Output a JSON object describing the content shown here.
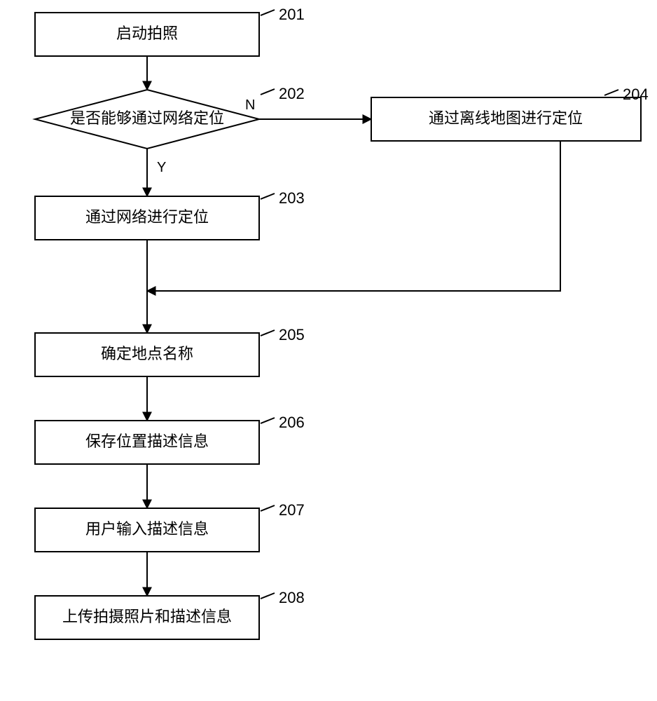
{
  "nodes": {
    "n201": {
      "label": "启动拍照",
      "ref": "201"
    },
    "n202": {
      "label": "是否能够通过网络定位",
      "ref": "202",
      "yes": "Y",
      "no": "N"
    },
    "n203": {
      "label": "通过网络进行定位",
      "ref": "203"
    },
    "n204": {
      "label": "通过离线地图进行定位",
      "ref": "204"
    },
    "n205": {
      "label": "确定地点名称",
      "ref": "205"
    },
    "n206": {
      "label": "保存位置描述信息",
      "ref": "206"
    },
    "n207": {
      "label": "用户输入描述信息",
      "ref": "207"
    },
    "n208": {
      "label": "上传拍摄照片和描述信息",
      "ref": "208"
    }
  },
  "chart_data": {
    "type": "flowchart",
    "nodes": [
      {
        "id": "201",
        "shape": "process",
        "text": "启动拍照"
      },
      {
        "id": "202",
        "shape": "decision",
        "text": "是否能够通过网络定位"
      },
      {
        "id": "203",
        "shape": "process",
        "text": "通过网络进行定位"
      },
      {
        "id": "204",
        "shape": "process",
        "text": "通过离线地图进行定位"
      },
      {
        "id": "205",
        "shape": "process",
        "text": "确定地点名称"
      },
      {
        "id": "206",
        "shape": "process",
        "text": "保存位置描述信息"
      },
      {
        "id": "207",
        "shape": "process",
        "text": "用户输入描述信息"
      },
      {
        "id": "208",
        "shape": "process",
        "text": "上传拍摄照片和描述信息"
      }
    ],
    "edges": [
      {
        "from": "201",
        "to": "202",
        "label": ""
      },
      {
        "from": "202",
        "to": "203",
        "label": "Y"
      },
      {
        "from": "202",
        "to": "204",
        "label": "N"
      },
      {
        "from": "203",
        "to": "205",
        "label": ""
      },
      {
        "from": "204",
        "to": "205",
        "label": ""
      },
      {
        "from": "205",
        "to": "206",
        "label": ""
      },
      {
        "from": "206",
        "to": "207",
        "label": ""
      },
      {
        "from": "207",
        "to": "208",
        "label": ""
      }
    ]
  }
}
